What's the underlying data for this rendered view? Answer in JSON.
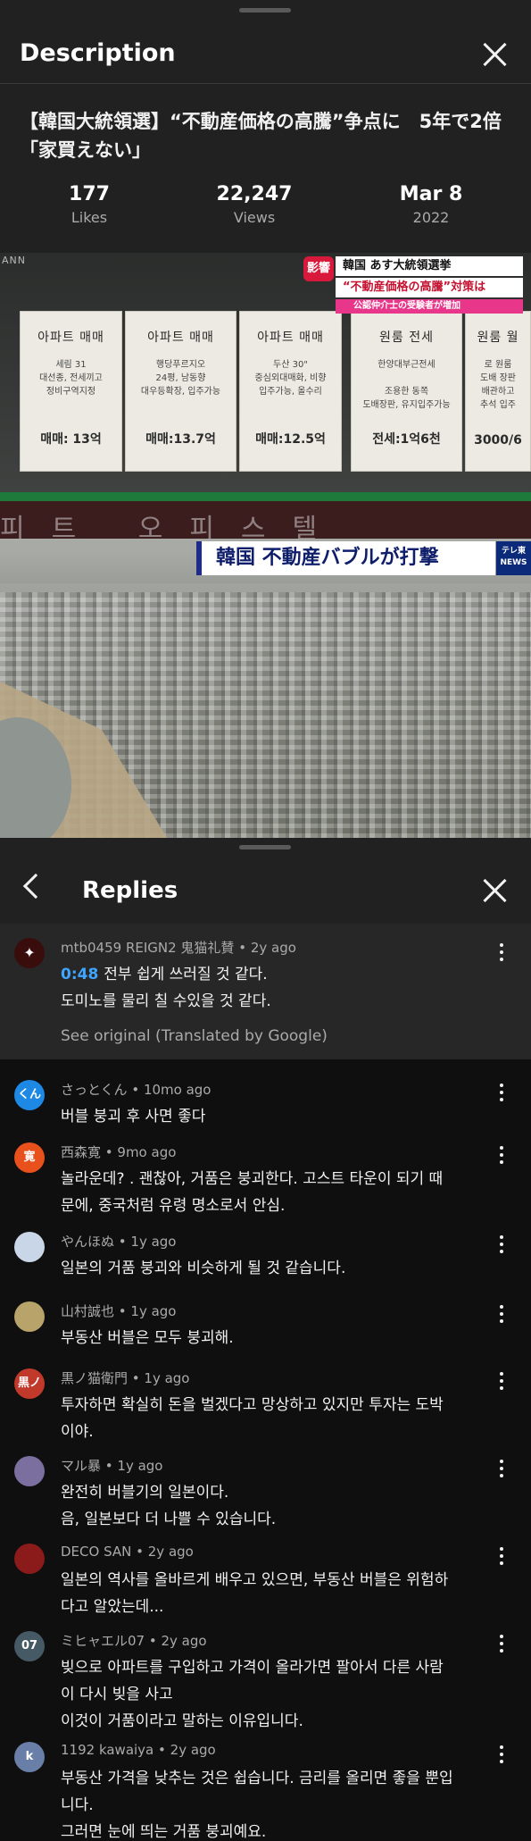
{
  "description": {
    "header_title": "Description",
    "video_title": "【韓国大統領選】“不動産価格の高騰”争点に　5年で2倍「家買えない」",
    "stats": [
      {
        "value": "177",
        "label": "Likes"
      },
      {
        "value": "22,247",
        "label": "Views"
      },
      {
        "value": "Mar 8",
        "label": "2022"
      }
    ],
    "thumbnail": {
      "top_logo": "ANN",
      "badge": "影響",
      "caption_line1": "韓国 あす大統領選挙",
      "caption_line2": "“不動産価格の高騰”対策は",
      "caption_line3": "公認仲介士の受験者が増加",
      "sheets": [
        {
          "head": "아파트 매매",
          "detail": "세림 31\n대선종, 전세끼고\n정비구역지정",
          "price": "매매: 13억"
        },
        {
          "head": "아파트 매매",
          "detail": "행당푸르지오\n24평, 남동향\n대우등확장, 입주가능",
          "price": "매매:13.7억"
        },
        {
          "head": "아파트 매매",
          "detail": "두산 30\"\n중심외대매화, 비향\n입주가능, 올수리",
          "price": "매매:12.5억"
        },
        {
          "head": "원룸 전세",
          "detail": "한양대부근전세\n\n조용한 동쪽\n도배장판, 유지입주가능",
          "price": "전세:1억6천"
        },
        {
          "head": "원룸 월",
          "detail": "로 원룸\n도배 장판\n배관하고\n추석 입주",
          "price": "3000/6"
        }
      ],
      "sign_text": "피트 오피스텔",
      "caption_bottom": "韓国 不動産バブルが打撃",
      "tv_logo": "テレ東 NEWS"
    }
  },
  "replies": {
    "header_title": "Replies",
    "highlighted": {
      "author": "mtb0459 REIGN2 鬼猫礼賛",
      "age": "2y ago",
      "timestamp": "0:48",
      "line1": "전부 쉽게 쓰러질 것 같다.",
      "line2": "도미노를 물리 칠 수있을 것 같다.",
      "see_original": "See original (Translated by Google)"
    },
    "items": [
      {
        "author": "さっとくん",
        "age": "10mo ago",
        "avatar": "くん",
        "color": "#1e88e5",
        "lines": [
          "버블 붕괴 후 사면 좋다"
        ]
      },
      {
        "author": "西森寛",
        "age": "9mo ago",
        "avatar": "寛",
        "color": "#e8501c",
        "lines": [
          "놀라운데? . 괜찮아, 거품은 붕괴한다. 고스트 타운이 되기 때",
          "문에, 중국처럼 유령 명소로서 안심."
        ]
      },
      {
        "author": "やんほぬ",
        "age": "1y ago",
        "avatar": "",
        "color": "#c8d6e8",
        "lines": [
          "일본의 거품 붕괴와 비슷하게 될 것 같습니다."
        ]
      },
      {
        "author": "山村誠也",
        "age": "1y ago",
        "avatar": "",
        "color": "#b8a46a",
        "lines": [
          "부동산 버블은 모두 붕괴해."
        ]
      },
      {
        "author": "黒ノ猫衛門",
        "age": "1y ago",
        "avatar": "黒ノ",
        "color": "#c0392b",
        "lines": [
          "투자하면 확실히 돈을 벌겠다고 망상하고 있지만 투자는 도박",
          "이야."
        ]
      },
      {
        "author": "マル暴",
        "age": "1y ago",
        "avatar": "",
        "color": "#7b6fa0",
        "lines": [
          "완전히 버블기의 일본이다.",
          "음, 일본보다 더 나쁠 수 있습니다."
        ]
      },
      {
        "author": "DECO SAN",
        "age": "2y ago",
        "avatar": "",
        "color": "#8b1a1a",
        "lines": [
          "일본의 역사를 올바르게 배우고 있으면, 부동산 버블은 위험하",
          "다고 알았는데..."
        ]
      },
      {
        "author": "ミヒャエル07",
        "age": "2y ago",
        "avatar": "07",
        "color": "#455a64",
        "lines": [
          "빚으로 아파트를 구입하고 가격이 올라가면 팔아서 다른 사람",
          "이 다시 빚을 사고",
          "이것이 거품이라고 말하는 이유입니다."
        ]
      },
      {
        "author": "1192 kawaiya",
        "age": "2y ago",
        "avatar": "k",
        "color": "#6a7fa8",
        "lines": [
          "부동산 가격을 낮추는 것은 쉽습니다. 금리를 올리면 좋을 뿐입",
          "니다.",
          "그러면 눈에 띄는 거품 붕괴예요."
        ]
      }
    ]
  }
}
